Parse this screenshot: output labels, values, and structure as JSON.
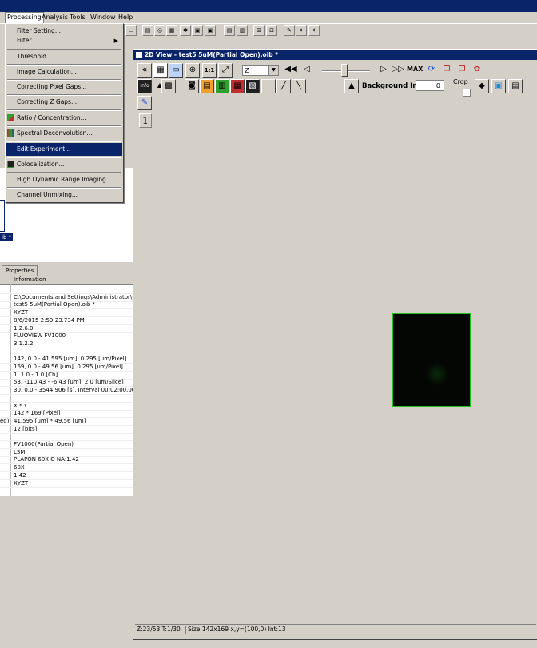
{
  "menubar": {
    "items": [
      "Processing",
      "Analysis",
      "Tools",
      "Window",
      "Help"
    ]
  },
  "processing_menu": {
    "items": [
      {
        "label": "Filter Setting...",
        "submenu": false
      },
      {
        "label": "Filter",
        "submenu": true
      },
      {
        "label": "Threshold...",
        "submenu": false
      },
      {
        "label": "Image Calculation...",
        "submenu": false
      },
      {
        "label": "Correcting Pixel Gaps...",
        "submenu": false
      },
      {
        "label": "Correcting Z Gaps...",
        "submenu": false
      },
      {
        "label": "Ratio / Concentration...",
        "submenu": false
      },
      {
        "label": "Spectral Deconvolution...",
        "submenu": false
      },
      {
        "label": "Edit Experiment...",
        "submenu": false,
        "highlighted": true
      },
      {
        "label": "Colocalization...",
        "submenu": false
      },
      {
        "label": "High Dynamic Range Imaging...",
        "submenu": false
      },
      {
        "label": "Channel Unmixing...",
        "submenu": false
      }
    ]
  },
  "left_panel": {
    "selected_file_label": "ib *",
    "properties_tab": "Properties",
    "info_header": "Information",
    "rows": [
      {
        "key": "",
        "value": ""
      },
      {
        "key": "",
        "value": "C:\\Documents and Settings\\Administrator\\De"
      },
      {
        "key": "",
        "value": "test5 5uM(Partial Open).oib *"
      },
      {
        "key": "",
        "value": "XYZT"
      },
      {
        "key": "",
        "value": "8/6/2015 2:59:23.734 PM"
      },
      {
        "key": "",
        "value": "1.2.6.0"
      },
      {
        "key": "",
        "value": "FLUOVIEW FV1000"
      },
      {
        "key": "",
        "value": "3.1.2.2"
      },
      {
        "key": "",
        "value": ""
      },
      {
        "key": "",
        "value": "142,  0.0 - 41.595 [um], 0.295 [um/Pixel]"
      },
      {
        "key": "",
        "value": "169,  0.0 - 49.56 [um], 0.295 [um/Pixel]"
      },
      {
        "key": "",
        "value": "1,  1.0 - 1.0 [Ch]"
      },
      {
        "key": "",
        "value": "53,  -110.43 - -6.43 [um], 2.0 [um/Slice]"
      },
      {
        "key": "",
        "value": "30,  0.0 - 3544.906 [s], Interval 00:02:00.00"
      },
      {
        "key": "",
        "value": ""
      },
      {
        "key": "",
        "value": "X * Y"
      },
      {
        "key": "",
        "value": "142 * 169 [Pixel]"
      },
      {
        "key": "ed)",
        "value": "41.595 [um] * 49.56 [um]"
      },
      {
        "key": "",
        "value": "12 [bits]"
      },
      {
        "key": "",
        "value": ""
      },
      {
        "key": "",
        "value": "FV1000(Partial Open)"
      },
      {
        "key": "",
        "value": "LSM"
      },
      {
        "key": "",
        "value": "PLAPON   60X O  NA:1.42"
      },
      {
        "key": "",
        "value": "60X"
      },
      {
        "key": "",
        "value": "1.42"
      },
      {
        "key": "",
        "value": "XYZT"
      }
    ]
  },
  "view_window": {
    "title": "2D View - test5 5uM(Partial Open).oib *",
    "axis_select": "Z",
    "max_label": "MAX",
    "background_label": "Background Int.",
    "background_value": "0",
    "crop_label": "Crop",
    "channel_number": "1",
    "btn_one_to_one": "1:1",
    "btn_info": "Info",
    "status_position": "Z:23/53 T:1/30",
    "status_info": "Size:142x169 x,y=(100,0) Int:13"
  },
  "colors": {
    "title_bar": "#0a246a",
    "highlight": "#0a246a",
    "face": "#d4d0c8",
    "image_border": "#20c020"
  }
}
